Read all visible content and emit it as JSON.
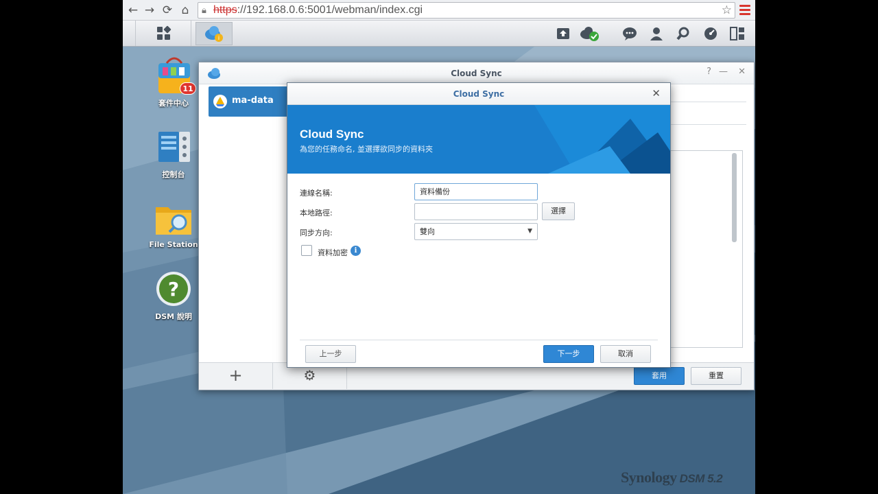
{
  "browser": {
    "url_scheme": "https",
    "url_rest": "://192.168.0.6:5001/webman/index.cgi"
  },
  "desktop": {
    "icons": [
      {
        "label": "套件中心",
        "badge": "11"
      },
      {
        "label": "控制台"
      },
      {
        "label": "File Station"
      },
      {
        "label": "DSM 說明"
      }
    ],
    "brand": "Synology",
    "brand_version": "DSM 5.2"
  },
  "main_window": {
    "title": "Cloud Sync",
    "task_item": "ma-data",
    "apply_label": "套用",
    "reset_label": "重置"
  },
  "dialog": {
    "title": "Cloud Sync",
    "banner_title": "Cloud Sync",
    "banner_subtitle": "為您的任務命名, 並選擇欲同步的資料夾",
    "fields": {
      "name_label": "連線名稱:",
      "name_value": "資料備份",
      "path_label": "本地路徑:",
      "path_value": "",
      "browse_label": "選擇",
      "direction_label": "同步方向:",
      "direction_value": "雙向",
      "encrypt_label": "資料加密"
    },
    "buttons": {
      "back": "上一步",
      "next": "下一步",
      "cancel": "取消"
    }
  },
  "colors": {
    "accent": "#2f7fc2",
    "banner": "#1a7ecd",
    "badge": "#e0352e"
  }
}
